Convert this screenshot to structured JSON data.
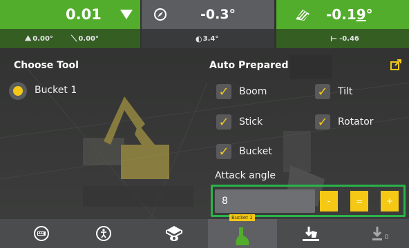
{
  "topbar": {
    "cell1": {
      "value": "0.01",
      "sub_left": "0.00°",
      "sub_right": "0.00°"
    },
    "cell2": {
      "value": "-0.3°",
      "sub": "3.4°"
    },
    "cell3": {
      "value": "-0.1",
      "value_sub": "9",
      "value_unit": "°",
      "sub": "-0.46"
    }
  },
  "left_panel": {
    "title": "Choose Tool",
    "tool_label": "Bucket 1"
  },
  "right_panel": {
    "title": "Auto Prepared",
    "checkboxes": {
      "boom": {
        "label": "Boom",
        "checked": true
      },
      "tilt": {
        "label": "Tilt",
        "checked": true
      },
      "stick": {
        "label": "Stick",
        "checked": true
      },
      "rotator": {
        "label": "Rotator",
        "checked": true
      },
      "bucket": {
        "label": "Bucket",
        "checked": true
      }
    },
    "attack_angle_label": "Attack angle",
    "attack_angle_value": "8",
    "btn_minus": "-",
    "btn_equal": "=",
    "btn_plus": "+"
  },
  "bottombar": {
    "active_tab_badge": "Bucket 1",
    "zero_label": "0"
  },
  "colors": {
    "accent_green": "#53ad2c",
    "yellow": "#f5c815",
    "highlight_green": "#2ab34a"
  }
}
